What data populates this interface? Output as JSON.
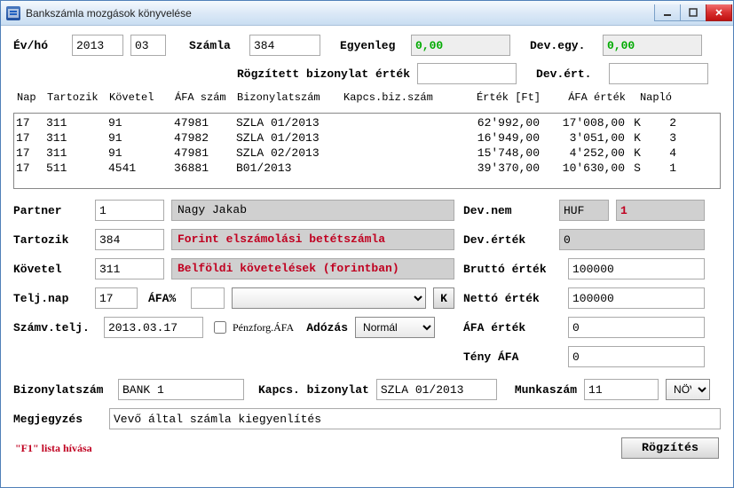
{
  "window": {
    "title": "Bankszámla mozgások könyvelése"
  },
  "top": {
    "evho_label": "Év/hó",
    "ev": "2013",
    "ho": "03",
    "szamla_label": "Számla",
    "szamla": "384",
    "egyenleg_label": "Egyenleg",
    "egyenleg": "0,00",
    "devegy_label": "Dev.egy.",
    "devegy": "0,00",
    "rogzbiz_label": "Rögzített bizonylat érték",
    "rogzbiz": "",
    "devert_label": "Dev.ért.",
    "devert": ""
  },
  "grid": {
    "headers": {
      "nap": "Nap",
      "tartozik": "Tartozik",
      "kovetel": "Követel",
      "afaszam": "ÁFA szám",
      "bizszam": "Bizonylatszám",
      "kapcsbiz": "Kapcs.biz.szám",
      "ertek": "Érték [Ft]",
      "afaertek": "ÁFA érték",
      "naplo": "Napló",
      "sor": ""
    },
    "rows": [
      {
        "nap": "17",
        "tart": "311",
        "kov": "91",
        "afa": "47981",
        "biz": "SZLA 01/2013",
        "kapcs": "",
        "ertek": "62'992,00",
        "afaert": "17'008,00",
        "naplo": "K",
        "sor": "2"
      },
      {
        "nap": "17",
        "tart": "311",
        "kov": "91",
        "afa": "47982",
        "biz": "SZLA 01/2013",
        "kapcs": "",
        "ertek": "16'949,00",
        "afaert": "3'051,00",
        "naplo": "K",
        "sor": "3"
      },
      {
        "nap": "17",
        "tart": "311",
        "kov": "91",
        "afa": "47981",
        "biz": "SZLA 02/2013",
        "kapcs": "",
        "ertek": "15'748,00",
        "afaert": "4'252,00",
        "naplo": "K",
        "sor": "4"
      },
      {
        "nap": "17",
        "tart": "511",
        "kov": "4541",
        "afa": "36881",
        "biz": "B01/2013",
        "kapcs": "",
        "ertek": "39'370,00",
        "afaert": "10'630,00",
        "naplo": "S",
        "sor": "1"
      }
    ]
  },
  "left": {
    "partner_label": "Partner",
    "partner_code": "1",
    "partner_name": "Nagy Jakab",
    "tartozik_label": "Tartozik",
    "tartozik_code": "384",
    "tartozik_desc": "Forint elszámolási betétszámla",
    "kovetel_label": "Követel",
    "kovetel_code": "311",
    "kovetel_desc": "Belföldi követelések (forintban)",
    "teljnap_label": "Telj.nap",
    "teljnap": "17",
    "afapct_label": "ÁFA%",
    "afapct": "",
    "afadesc": "",
    "naplo_btn": "K",
    "szamvtelj_label": "Számv.telj.",
    "szamvtelj": "2013.03.17",
    "penzforg_label": "Pénzforg.ÁFA",
    "adozas_label": "Adózás",
    "adozas_value": "Normál"
  },
  "right": {
    "devnem_label": "Dev.nem",
    "devnem": "HUF",
    "devrate": "1",
    "devertek_label": "Dev.érték",
    "devertek": "0",
    "brutto_label": "Bruttó érték",
    "brutto": "100000",
    "netto_label": "Nettó érték",
    "netto": "100000",
    "afaertek_label": "ÁFA érték",
    "afaertek": "0",
    "tenyafa_label": "Tény ÁFA",
    "tenyafa": "0"
  },
  "bottom": {
    "bizszam_label": "Bizonylatszám",
    "bizszam": "BANK 1",
    "kapcsbiz_label": "Kapcs. bizonylat",
    "kapcsbiz": "SZLA 01/2013",
    "munkaszam_label": "Munkaszám",
    "munkaszam": "11",
    "nov": "NÖV",
    "megj_label": "Megjegyzés",
    "megj": "Vevő által számla kiegyenlítés"
  },
  "footer": {
    "hint": "\"F1\" lista hívása",
    "submit": "Rögzítés"
  }
}
